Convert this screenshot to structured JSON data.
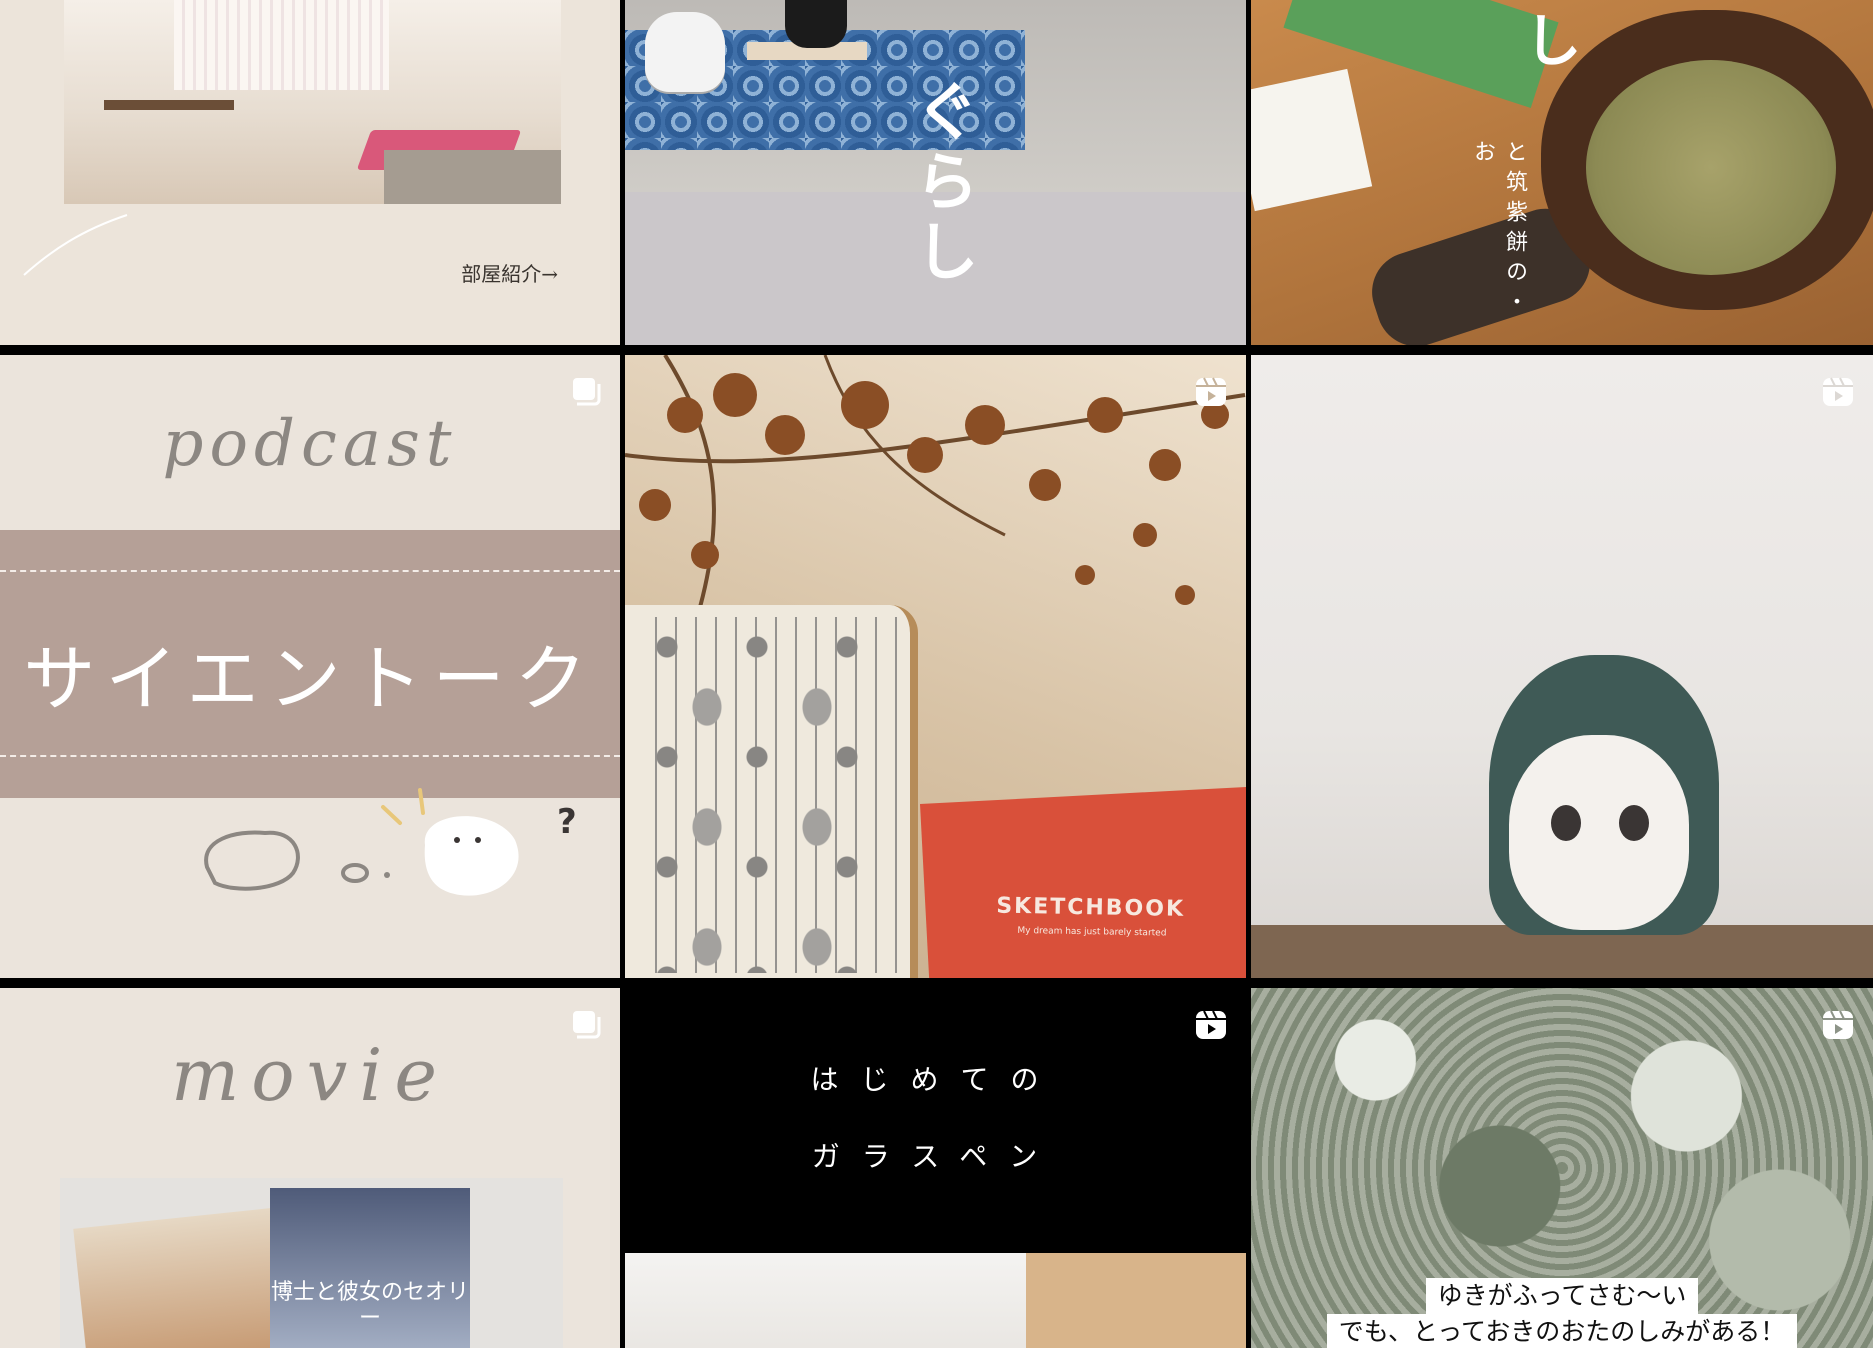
{
  "tiles": [
    {
      "id": "room-tour",
      "caption": "部屋紹介→",
      "badge": null
    },
    {
      "id": "kurashi",
      "overlay_text": "ぐらし",
      "badge": null
    },
    {
      "id": "matcha-mug",
      "overlay_text": "と筑紫餅の・お",
      "overlay_char": "し",
      "badge": null
    },
    {
      "id": "podcast",
      "script_title": "podcast",
      "title": "サイエントーク",
      "question_mark": "?",
      "badge": "carousel-icon"
    },
    {
      "id": "sketchbook",
      "book_label": "SKETCHBOOK",
      "book_subtitle": "My dream has just barely started",
      "badge": "reels-icon"
    },
    {
      "id": "figure",
      "badge": "reels-icon"
    },
    {
      "id": "movie",
      "script_title": "movie",
      "dvd_title": "博士と彼女のセオリー",
      "badge": "carousel-icon"
    },
    {
      "id": "glass-pen",
      "line1": "はじめての",
      "line2": "ガラスペン",
      "badge": "reels-icon"
    },
    {
      "id": "snow",
      "caption_line1": "ゆきがふってさむ〜い",
      "caption_line2": "でも、とっておきのおたのしみがある！",
      "badge": "reels-icon"
    }
  ],
  "colors": {
    "grid_gap": "#000000",
    "beige": "#ebe4dc",
    "mocha_band": "#b5a097",
    "badge": "#ffffff"
  }
}
